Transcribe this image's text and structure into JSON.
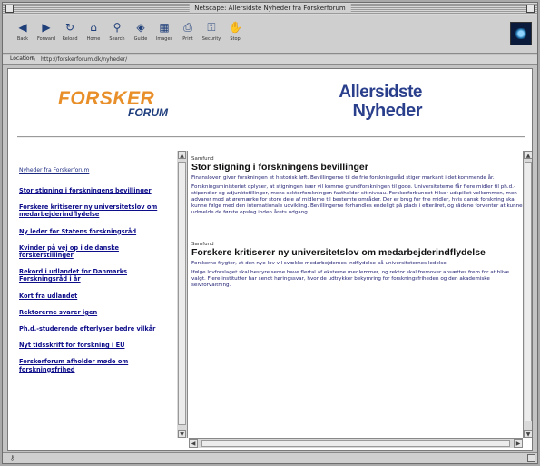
{
  "window": {
    "title": "Netscape: Allersidste Nyheder fra Forskerforum"
  },
  "toolbar": {
    "buttons": [
      {
        "label": "Back",
        "icon": "back-arrow-icon",
        "glyph": "◀"
      },
      {
        "label": "Forward",
        "icon": "forward-arrow-icon",
        "glyph": "▶"
      },
      {
        "label": "Reload",
        "icon": "reload-icon",
        "glyph": "↻"
      },
      {
        "label": "Home",
        "icon": "home-icon",
        "glyph": "⌂"
      },
      {
        "label": "Search",
        "icon": "search-icon",
        "glyph": "⚲"
      },
      {
        "label": "Guide",
        "icon": "guide-icon",
        "glyph": "◈"
      },
      {
        "label": "Images",
        "icon": "images-icon",
        "glyph": "▦"
      },
      {
        "label": "Print",
        "icon": "print-icon",
        "glyph": "⎙"
      },
      {
        "label": "Security",
        "icon": "security-lock-icon",
        "glyph": "⚿"
      },
      {
        "label": "Stop",
        "icon": "stop-icon",
        "glyph": "✋"
      }
    ]
  },
  "location": {
    "label": "Location:",
    "url": "http://forskerforum.dk/nyheder/"
  },
  "page": {
    "logo_left_1": "FORSKER",
    "logo_left_2": "FORUM",
    "logo_right_1": "Allersidste",
    "logo_right_2": "Nyheder"
  },
  "sidebar": {
    "subtitle": "Nyheder fra Forskerforum",
    "links": [
      "Stor stigning i forskningens bevillinger",
      "Forskere kritiserer ny universitetslov om medarbejderindflydelse",
      "Ny leder for Statens forskningsråd",
      "Kvinder på vej op i de danske forskerstillinger",
      "Rekord i udlandet for Danmarks Forskningsråd i år",
      "Kort fra udlandet",
      "Rektorerne svarer igen",
      "Ph.d.-studerende efterlyser bedre vilkår",
      "Nyt tidsskrift for forskning i EU",
      "Forskerforum afholder møde om forskningsfrihed"
    ]
  },
  "articles": [
    {
      "kicker": "Samfund",
      "headline": "Stor stigning i forskningens bevillinger",
      "lead": "Finansloven giver forskningen et historisk løft. Bevillingerne til de frie forskningsråd stiger markant i det kommende år.",
      "body": "Forskningsministeriet oplyser, at stigningen især vil komme grundforskningen til gode. Universiteterne får flere midler til ph.d.-stipendier og adjunktstillinger, mens sektorforskningen fastholder sit niveau. Forskerforbundet hilser udspillet velkommen, men advarer mod at øremærke for store dele af midlerne til bestemte områder. Der er brug for frie midler, hvis dansk forskning skal kunne følge med den internationale udvikling. Bevillingerne forhandles endeligt på plads i efteråret, og rådene forventer at kunne udmelde de første opslag inden årets udgang."
    },
    {
      "kicker": "Samfund",
      "headline": "Forskere kritiserer ny universitetslov om medarbejderindflydelse",
      "lead": "Forskerne frygter, at den nye lov vil svække medarbejdernes indflydelse på universiteternes ledelse.",
      "body": "Ifølge lovforslaget skal bestyrelserne have flertal af eksterne medlemmer, og rektor skal fremover ansættes frem for at blive valgt. Flere institutter har sendt høringssvar, hvor de udtrykker bekymring for forskningsfriheden og den akademiske selvforvaltning."
    }
  ]
}
